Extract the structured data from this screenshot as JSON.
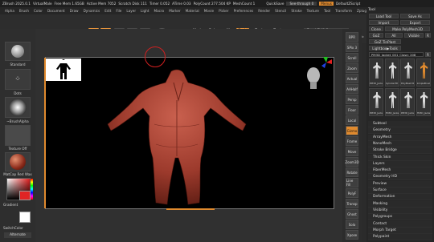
{
  "titlebar": {
    "items": [
      "ZBrush 2025.0.1",
      "VirtualMale",
      "Free Mem 1.65GB",
      "Active Mem 7052",
      "Scratch Disk 111",
      "Timer 0.052",
      "ATime 0.03",
      "PolyCount 277.504 KP",
      "MeshCount 1"
    ],
    "quicksave": "QuickSave",
    "see_through": "See-through 0",
    "menus_label": "Menus",
    "default_script": "DefaultZScript"
  },
  "menubar": [
    "Alpha",
    "Brush",
    "Color",
    "Document",
    "Draw",
    "Dynamics",
    "Edit",
    "File",
    "Layer",
    "Light",
    "Macro",
    "Marker",
    "Material",
    "Movie",
    "Picker",
    "Preferences",
    "Render",
    "Stencil",
    "Stroke",
    "Texture",
    "Tool",
    "Transform",
    "Zplugin",
    "Zscript"
  ],
  "shelf": {
    "home_page": "Home Page",
    "lightbox": "LightBox",
    "live_boolean": "Live Boolean",
    "edit": "Edit",
    "draw": "Draw",
    "move": "Move",
    "scale": "Scale",
    "rotate": "Rotate",
    "a_label": "A",
    "mrgb": "Mrgb",
    "rgb": "Rgb",
    "m": "M",
    "zadd": "Zadd",
    "zsub": "Zsub",
    "zcut": "Zcut",
    "rgb_intensity": "Rgb Intensity",
    "z_intensity": "Z Intensity 25",
    "focal_shift": "Focal Shift 0",
    "draw_size": "Draw Size 64",
    "dynamic": "Dynamic"
  },
  "left": {
    "brush_label": "Standard",
    "stroke_label": "Dots",
    "alpha_label": "~BrushAlpha",
    "texture_label": "Texture Off",
    "material_label": "MatCap Red Wax",
    "gradient_label": "Gradient",
    "switch_color": "SwitchColor",
    "alternate": "Alternate"
  },
  "right_tools": [
    "BPR",
    "SPix 3",
    "Scroll",
    "Zoom",
    "Actual",
    "AAHalf",
    "Persp",
    "Floor",
    "Local",
    "Gizmo",
    "Frame",
    "Move",
    "Zoom3D",
    "Rotate",
    "Line Fill",
    "PolyF",
    "Transp",
    "Ghost",
    "Solo",
    "Xpose"
  ],
  "tool_panel": {
    "header": "Tool",
    "load_tool": "Load Tool",
    "save_as": "Save As",
    "import": "Import",
    "export": "Export",
    "clone": "Clone",
    "make_polymesh": "Make PolyMesh3D",
    "goz": "GoZ",
    "all": "All",
    "visible": "Visible",
    "r": "R",
    "goz_ttwpfol": "GoZ TinPlast",
    "lightbox_tools": "Lightbox▶Tools",
    "current_tool": "PM3D_Jacket_001_Close: 208",
    "r2": "R",
    "thumb_labels": [
      "PM3D_Jacket_001",
      "Cylinder3D",
      "PolyMesh3D",
      "SimpleBrush",
      "PM3D_Jacket_00",
      "PM3D_Jacket_00",
      "PM3D_Jacket_00",
      "PM3D_Jacket_00"
    ],
    "menu": [
      "Subtool",
      "Geometry",
      "ArrayMesh",
      "NanoMesh",
      "Stroke Bridge",
      "Thick Skin",
      "Layers",
      "FiberMesh",
      "Geometry HD",
      "Preview",
      "Surface",
      "Deformation",
      "Masking",
      "Visibility",
      "Polygroups",
      "Contact",
      "Morph Target",
      "Polypaint"
    ]
  },
  "colors": {
    "accent": "#e08a2e",
    "skin": "#b5473c",
    "bg": "#2b2b2b"
  }
}
